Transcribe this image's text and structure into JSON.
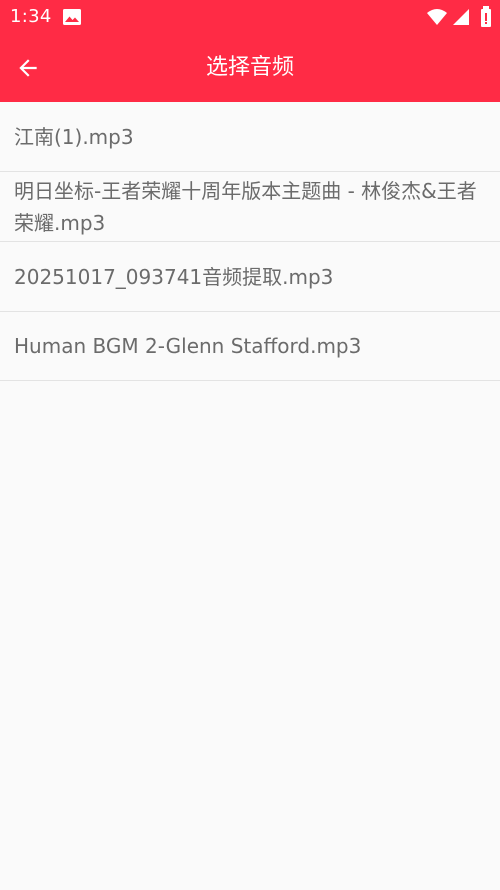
{
  "status_bar": {
    "time": "1:34",
    "icons": [
      "gallery-icon",
      "wifi-icon",
      "signal-icon",
      "battery-icon"
    ]
  },
  "app_bar": {
    "title": "选择音频",
    "back_icon": "arrow-left-icon",
    "color": "#ff2b45"
  },
  "audio_files": [
    "江南(1).mp3",
    "明日坐标-王者荣耀十周年版本主题曲 - 林俊杰&王者荣耀.mp3",
    "20251017_093741音频提取.mp3",
    "Human BGM 2-Glenn Stafford.mp3"
  ]
}
